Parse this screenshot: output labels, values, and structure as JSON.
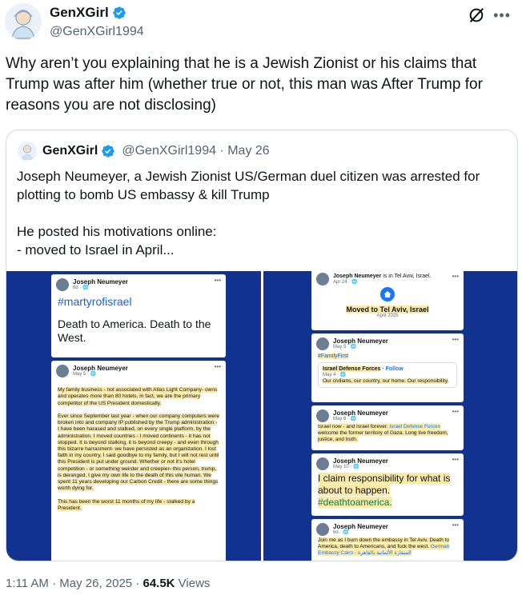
{
  "author": {
    "name": "GenXGirl",
    "handle": "@GenXGirl1994"
  },
  "tweet": {
    "text": "Why aren’t you explaining that he is a Jewish Zionist or his claims that Trump was after him (whether true or not, this man was After Trump for reasons you are not disclosing)",
    "timestamp": "1:11 AM · May 26, 2025 · ",
    "views_count": "64.5K",
    "views_label": " Views"
  },
  "quote": {
    "name": "GenXGirl",
    "handle": "@GenXGirl1994 · May 26",
    "text": "Joseph Neumeyer, a Jewish Zionist US/German duel citizen was arrested for plotting to bomb US embassy & kill Trump\n\nHe posted his motivations online:\n- moved to Israel in April..."
  },
  "media": {
    "left": {
      "post1": {
        "name": "Joseph Neumeyer",
        "date": "6d · ",
        "hashtag": "#martyrofisrael",
        "text": "Death to America. Death to the West."
      },
      "post2": {
        "name": "Joseph Neumeyer",
        "date": "May 5 · ",
        "text": "My family business - not associated with Atlas Light Company- owns and operates more than 80 hotels, in fact, we are the primary competitor of the US President domestically.\n\nEver since September last year - when our company computers were broken into and company IP published by the Trump administration - I have been harased and stalked, on every single platform, by the administration. I moved countries - I moved continents - it has not stopped. It is beyond stalking, it is beyond creepy - and even through this bizarre harrasment- we have persisted as an organization. I lost faith in my country, I said goodbye to my family, but I will not rest until this President is put under ground. Whether or not it's hotel competition - or something weirder and creepier- this person, trump, is deranged. I give my own life to the death of this vile human. We spent 11 years developing our Carbon Credit - there are some things worth dying for.\n\nThis has been the worst 11 months of my life - stalked by a President."
      }
    },
    "right": {
      "post1": {
        "name": "Joseph Neumeyer",
        "location": " is in Tel Aviv, Israel.",
        "date": "Apr 24 · ",
        "event": "Moved to Tel Aviv, Israel",
        "event_date": "April 2025"
      },
      "post2": {
        "name": "Joseph Neumeyer",
        "date": "May 5 · ",
        "hashtag": "#FamilyFirst",
        "shared_name": "Israel Defense Forces",
        "shared_follow": " · Follow",
        "shared_date": "May 4 · ",
        "shared_text": "Our civilians, our country, our home. Our responsibility."
      },
      "post3": {
        "name": "Joseph Neumeyer",
        "date": "May 6 · ",
        "text": "Israel now - and Israel forever. ",
        "link": "Israel Defense Forces",
        "text2": " welcome the former territory of Gaza. Long live freedom, justice, and truth."
      },
      "post4": {
        "name": "Joseph Neumeyer",
        "date": "May 10 · ",
        "text": "I claim responsibility for what is about to happen.",
        "hashtag": "#deathtoamerica."
      },
      "post5": {
        "name": "Joseph Neumeyer",
        "date": "6d · ",
        "text": "Join me as I burn down the embassy in Tel Aviv. Death to America, death to Americans, and fuck the west. ",
        "link": "German Embassy Cairo - السفارة الألمانية بالقاهرة"
      }
    }
  }
}
